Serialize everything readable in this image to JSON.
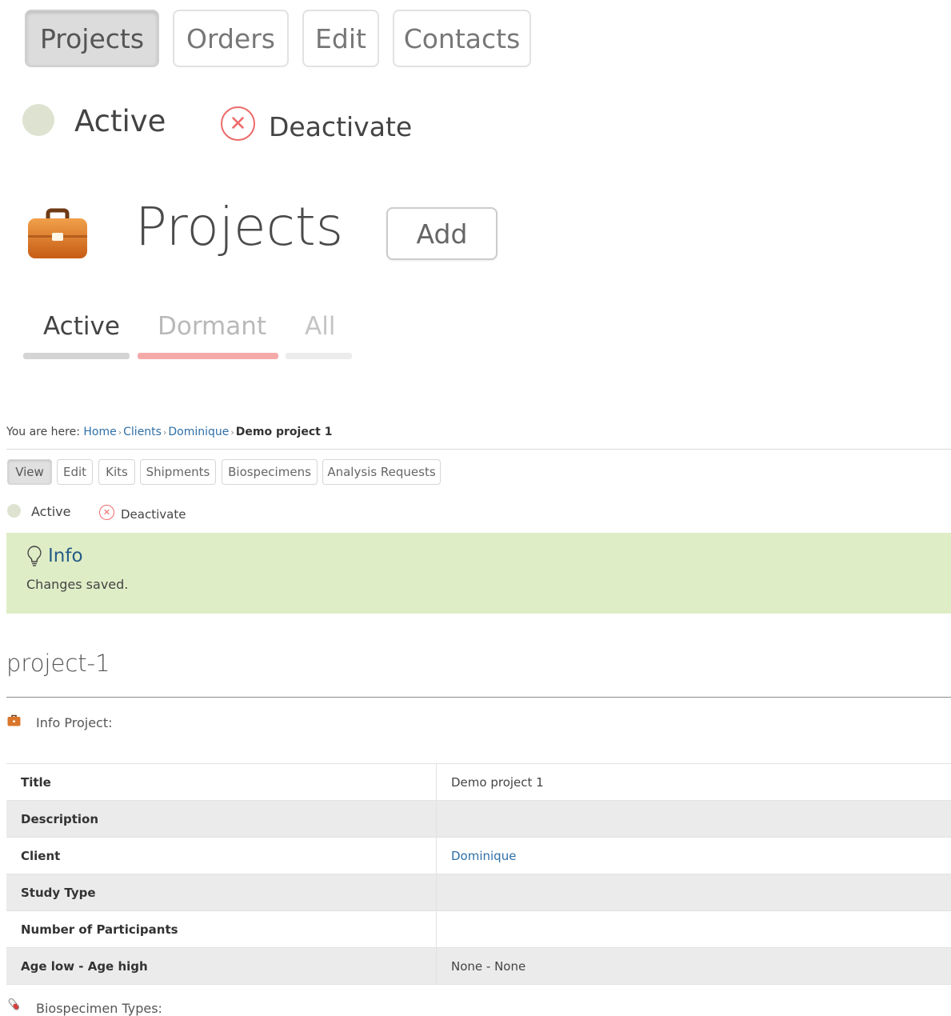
{
  "zoom": {
    "tabs": [
      {
        "label": "Projects",
        "active": true
      },
      {
        "label": "Orders",
        "active": false
      },
      {
        "label": "Edit",
        "active": false
      },
      {
        "label": "Contacts",
        "active": false
      }
    ],
    "status_label": "Active",
    "deactivate_label": "Deactivate",
    "heading": "Projects",
    "add_label": "Add",
    "filters": [
      {
        "label": "Active",
        "bar_color": "#d4d4d4"
      },
      {
        "label": "Dormant",
        "bar_color": "#f5aaaa"
      },
      {
        "label": "All",
        "bar_color": "#ececec"
      }
    ]
  },
  "breadcrumb": {
    "prefix": "You are here:",
    "items": [
      "Home",
      "Clients",
      "Dominique"
    ],
    "current": "Demo project 1"
  },
  "tabs": [
    "View",
    "Edit",
    "Kits",
    "Shipments",
    "Biospecimens",
    "Analysis Requests"
  ],
  "status": {
    "label": "Active",
    "deactivate_label": "Deactivate"
  },
  "info": {
    "title": "Info",
    "message": "Changes saved."
  },
  "project_id": "project-1",
  "info_section_label": "Info Project:",
  "fields": [
    {
      "label": "Title",
      "value": "Demo project 1"
    },
    {
      "label": "Description",
      "value": ""
    },
    {
      "label": "Client",
      "value": "Dominique"
    },
    {
      "label": "Study Type",
      "value": ""
    },
    {
      "label": "Number of Participants",
      "value": ""
    },
    {
      "label": "Age low - Age high",
      "value": "None - None"
    }
  ],
  "biospecimen_section_label": "Biospecimen Types:",
  "colors": {
    "accent_link": "#2f6fa7",
    "info_bg": "#dfedc6",
    "deactivate": "#ee6a6a"
  }
}
